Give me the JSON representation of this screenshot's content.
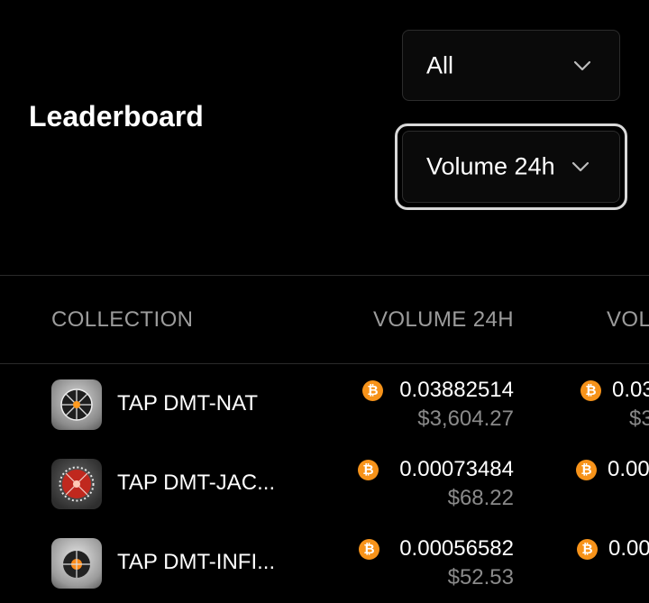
{
  "page": {
    "title": "Leaderboard"
  },
  "filters": {
    "scope": {
      "selected": "All"
    },
    "metric": {
      "selected": "Volume 24h"
    }
  },
  "table": {
    "columns": [
      "COLLECTION",
      "VOLUME 24H",
      "VOL"
    ],
    "rows": [
      {
        "name": "TAP DMT-NAT",
        "volume_24h_btc": "0.03882514",
        "volume_24h_usd": "$3,604.27",
        "volume_btc": "0.03",
        "volume_usd": "$3"
      },
      {
        "name": "TAP DMT-JAC...",
        "volume_24h_btc": "0.00073484",
        "volume_24h_usd": "$68.22",
        "volume_btc": "0.00",
        "volume_usd": ""
      },
      {
        "name": "TAP DMT-INFI...",
        "volume_24h_btc": "0.00056582",
        "volume_24h_usd": "$52.53",
        "volume_btc": "0.00",
        "volume_usd": ""
      }
    ]
  },
  "icons": {
    "currency": "bitcoin-icon",
    "dropdown": "chevron-down-icon"
  },
  "colors": {
    "background": "#000000",
    "bitcoin": "#f7931a",
    "muted_text": "#8a8a8a",
    "header_text": "#9c9c9c"
  }
}
